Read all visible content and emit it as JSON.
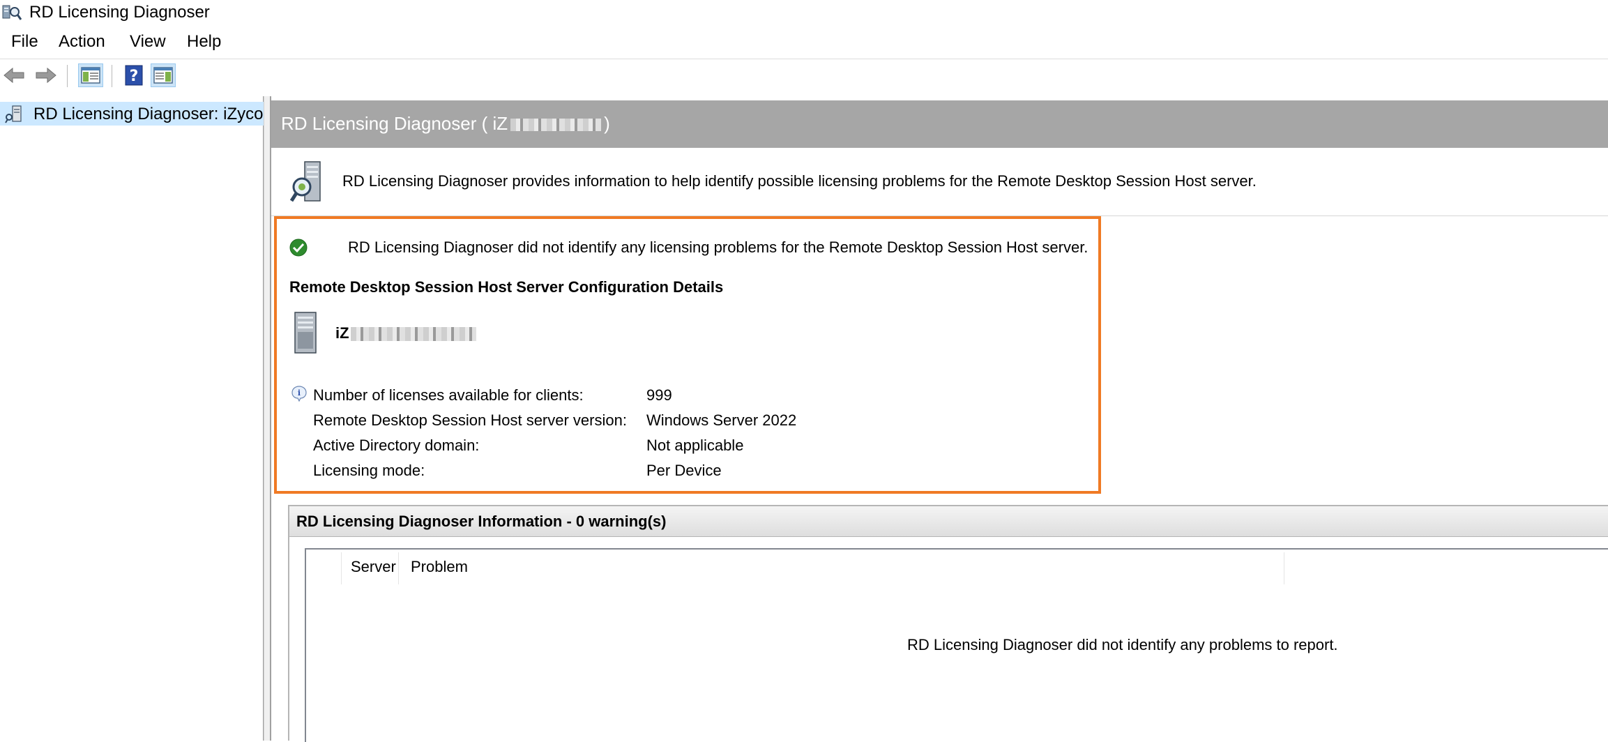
{
  "window": {
    "title": "RD Licensing Diagnoser"
  },
  "menu": {
    "items": [
      "File",
      "Action",
      "View",
      "Help"
    ]
  },
  "toolbar": {
    "buttons": [
      "back-arrow-icon",
      "forward-arrow-icon",
      "show-hide-console-tree-icon",
      "help-icon",
      "show-hide-action-pane-icon"
    ]
  },
  "tree": {
    "root_label": "RD Licensing Diagnoser: iZycoe"
  },
  "header": {
    "title_prefix": "RD Licensing Diagnoser ( iZ",
    "title_suffix": ")"
  },
  "intro": {
    "text": "RD Licensing Diagnoser provides information to help identify possible licensing problems for the Remote Desktop Session Host server."
  },
  "status": {
    "text": "RD Licensing Diagnoser did not identify any licensing problems for the Remote Desktop Session Host server."
  },
  "config": {
    "heading": "Remote Desktop Session Host Server Configuration Details",
    "server_name_prefix": "iZ",
    "details": [
      {
        "label": "Number of licenses available for clients:",
        "value": "999"
      },
      {
        "label": "Remote Desktop Session Host server version:",
        "value": "Windows Server 2022"
      },
      {
        "label": "Active Directory domain:",
        "value": "Not applicable"
      },
      {
        "label": "Licensing mode:",
        "value": "Per Device"
      }
    ]
  },
  "info_panel": {
    "title": "RD Licensing Diagnoser Information - 0 warning(s)",
    "columns": [
      "Server",
      "Problem"
    ],
    "empty_message": "RD Licensing Diagnoser did not identify any problems to report."
  },
  "colors": {
    "highlight_border": "#f07a24",
    "header_bar": "#a6a6a6",
    "tree_selection": "#cce8ff"
  }
}
